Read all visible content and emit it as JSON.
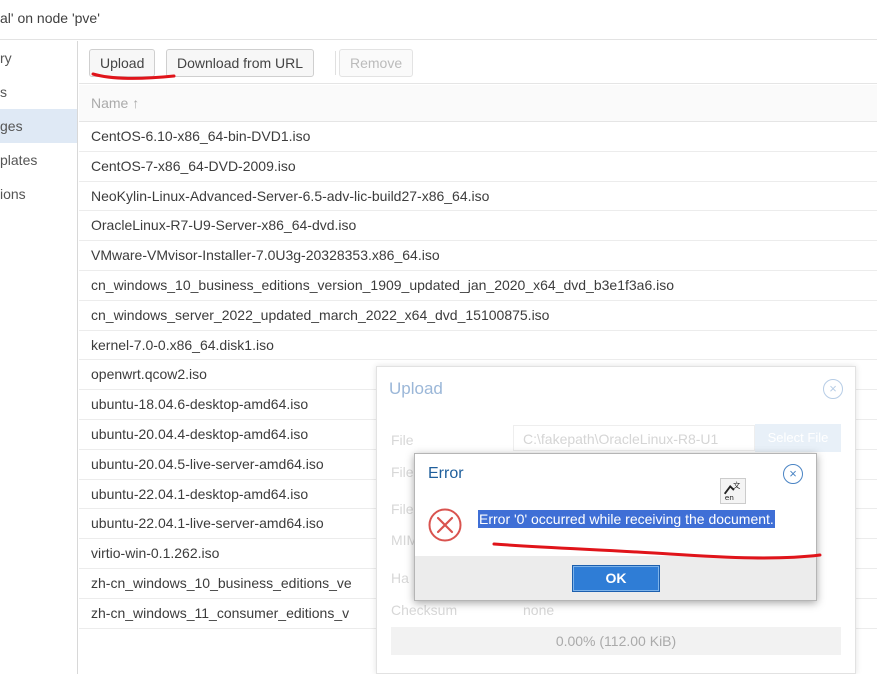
{
  "header": {
    "title": "al' on node 'pve'"
  },
  "sidebar": {
    "items": [
      {
        "label": "ry",
        "active": false
      },
      {
        "label": "s",
        "active": false
      },
      {
        "label": "ges",
        "active": true
      },
      {
        "label": "plates",
        "active": false
      },
      {
        "label": "ions",
        "active": false
      }
    ]
  },
  "toolbar": {
    "upload_label": "Upload",
    "download_label": "Download from URL",
    "remove_label": "Remove"
  },
  "grid": {
    "column_header": "Name ↑",
    "rows": [
      "CentOS-6.10-x86_64-bin-DVD1.iso",
      "CentOS-7-x86_64-DVD-2009.iso",
      "NeoKylin-Linux-Advanced-Server-6.5-adv-lic-build27-x86_64.iso",
      "OracleLinux-R7-U9-Server-x86_64-dvd.iso",
      "VMware-VMvisor-Installer-7.0U3g-20328353.x86_64.iso",
      "cn_windows_10_business_editions_version_1909_updated_jan_2020_x64_dvd_b3e1f3a6.iso",
      "cn_windows_server_2022_updated_march_2022_x64_dvd_15100875.iso",
      "kernel-7.0-0.x86_64.disk1.iso",
      "openwrt.qcow2.iso",
      "ubuntu-18.04.6-desktop-amd64.iso",
      "ubuntu-20.04.4-desktop-amd64.iso",
      "ubuntu-20.04.5-live-server-amd64.iso",
      "ubuntu-22.04.1-desktop-amd64.iso",
      "ubuntu-22.04.1-live-server-amd64.iso",
      "virtio-win-0.1.262.iso",
      "zh-cn_windows_10_business_editions_ve",
      "zh-cn_windows_11_consumer_editions_v"
    ]
  },
  "upload_window": {
    "title": "Upload",
    "file_label": "File",
    "file_value": "C:\\fakepath\\OracleLinux-R8-U1",
    "select_file_label": "Select File",
    "filename_label": "File",
    "filesize_label": "File",
    "mime_label": "MIM",
    "hash_label": "Ha",
    "checksum_label": "Checksum",
    "checksum_value": "none",
    "progress_text": "0.00% (112.00 KiB)",
    "progress_fraction": 0.0
  },
  "error_dialog": {
    "title": "Error",
    "message": "Error '0' occurred while receiving the document.",
    "ok_label": "OK"
  },
  "colors": {
    "accent": "#2f7dd6",
    "error_red": "#d9534f",
    "annotation_red": "#e0141a",
    "selection": "#3f6fd6"
  }
}
